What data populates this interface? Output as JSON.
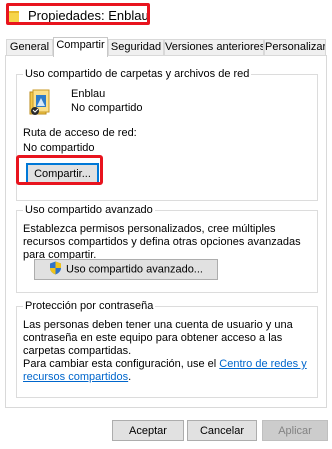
{
  "window": {
    "title": "Propiedades: Enblau"
  },
  "tabs": [
    {
      "label": "General"
    },
    {
      "label": "Compartir"
    },
    {
      "label": "Seguridad"
    },
    {
      "label": "Versiones anteriores"
    },
    {
      "label": "Personalizar"
    }
  ],
  "network_sharing": {
    "group_title": "Uso compartido de carpetas y archivos de red",
    "folder_icon": "shared-folder-icon",
    "folder_name": "Enblau",
    "folder_status": "No compartido",
    "path_label": "Ruta de acceso de red:",
    "path_value": "No compartido",
    "share_button": "Compartir..."
  },
  "advanced_sharing": {
    "group_title": "Uso compartido avanzado",
    "description": "Establezca permisos personalizados, cree múltiples recursos compartidos y defina otras opciones avanzadas para compartir.",
    "button_icon": "uac-shield-icon",
    "button_label": "Uso compartido avanzado..."
  },
  "password_protection": {
    "group_title": "Protección por contraseña",
    "description": "Las personas deben tener una cuenta de usuario y una contraseña en este equipo para obtener acceso a las carpetas compartidas.",
    "change_prefix": "Para cambiar esta configuración, use el",
    "link_text": "Centro de redes y recursos compartidos",
    "change_suffix": "."
  },
  "footer": {
    "ok": "Aceptar",
    "cancel": "Cancelar",
    "apply": "Aplicar"
  },
  "colors": {
    "highlight_annotation": "#e8141e",
    "link": "#0066cc",
    "default_button_border": "#0078d7"
  }
}
